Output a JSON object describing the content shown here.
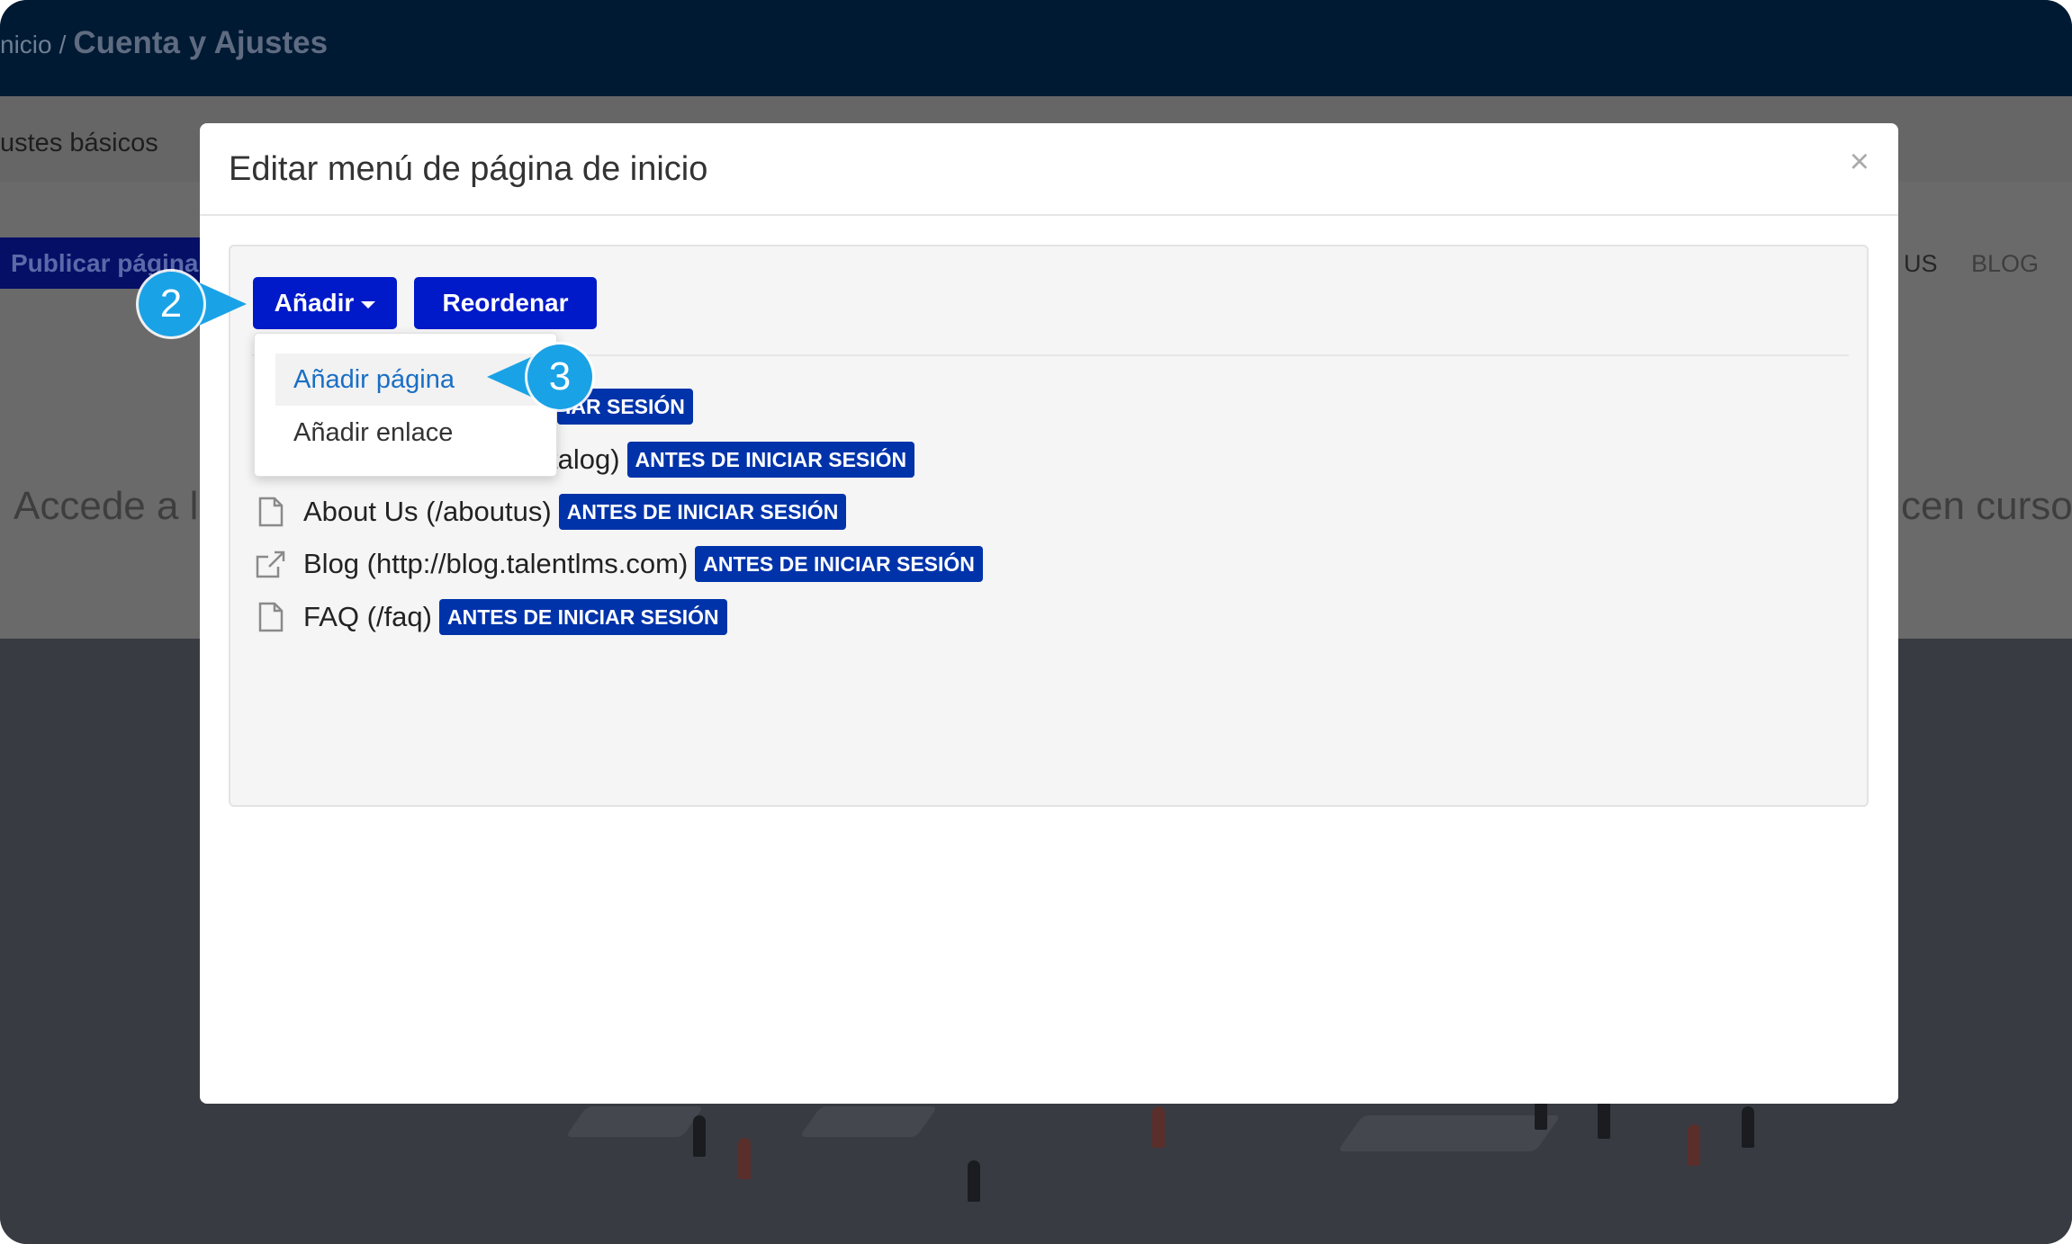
{
  "background": {
    "breadcrumb": {
      "home": "nicio",
      "separator": "/",
      "current": "Cuenta y Ajustes"
    },
    "tab_label": "ustes básicos",
    "publish_button": "Publicar página",
    "nav_us": "US",
    "nav_blog": "BLOG",
    "hero_left": "Accede a la",
    "hero_right": "cen curso"
  },
  "modal": {
    "title": "Editar menú de página de inicio",
    "close_glyph": "×",
    "add_button": "Añadir",
    "reorder_button": "Reordenar",
    "dropdown": {
      "items": [
        {
          "label": "Añadir página",
          "active": true
        },
        {
          "label": "Añadir enlace",
          "active": false
        }
      ]
    },
    "menu_items": [
      {
        "label": "",
        "badge": "IAR SESIÓN",
        "icon": "file-icon"
      },
      {
        "label": "talog)",
        "badge": "ANTES DE INICIAR SESIÓN",
        "icon": "file-icon"
      },
      {
        "label": "About Us (/aboutus)",
        "badge": "ANTES DE INICIAR SESIÓN",
        "icon": "file-icon"
      },
      {
        "label": "Blog (http://blog.talentlms.com)",
        "badge": "ANTES DE INICIAR SESIÓN",
        "icon": "external-link-icon"
      },
      {
        "label": "FAQ (/faq)",
        "badge": "ANTES DE INICIAR SESIÓN",
        "icon": "file-icon"
      }
    ]
  },
  "callouts": {
    "step_2": "2",
    "step_3": "3",
    "color": "#1aa2e6"
  },
  "colors": {
    "primary_button": "#0019c9",
    "badge": "#0033aa",
    "link_active": "#1a6fc4"
  }
}
